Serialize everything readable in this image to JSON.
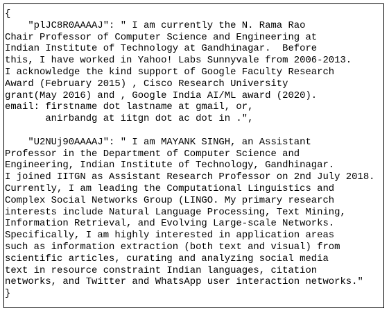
{
  "document": {
    "lines": [
      "{",
      "    \"plJC8R0AAAAJ\": \" I am currently the N. Rama Rao",
      "Chair Professor of Computer Science and Engineering at",
      "Indian Institute of Technology at Gandhinagar.  Before",
      "this, I have worked in Yahoo! Labs Sunnyvale from 2006-2013.",
      "I acknowledge the kind support of Google Faculty Research",
      "Award (February 2015) , Cisco Research University",
      "grant(May 2016) and , Google India AI/ML award (2020).",
      "email: firstname dot lastname at gmail, or,",
      "       anirbandg at iitgn dot ac dot in .\",",
      "",
      "    \"U2NUj90AAAAJ\": \" I am MAYANK SINGH, an Assistant",
      "Professor in the Department of Computer Science and",
      "Engineering, Indian Institute of Technology, Gandhinagar.",
      "I joined IITGN as Assistant Research Professor on 2nd July 2018.",
      "Currently, I am leading the Computational Linguistics and",
      "Complex Social Networks Group (LINGO. My primary research",
      "interests include Natural Language Processing, Text Mining,",
      "Information Retrieval, and Evolving Large-scale Networks.",
      "Specifically, I am highly interested in application areas",
      "such as information extraction (both text and visual) from",
      "scientific articles, curating and analyzing social media",
      "text in resource constraint Indian languages, citation",
      "networks, and Twitter and WhatsApp user interaction networks.\"",
      "}"
    ]
  }
}
